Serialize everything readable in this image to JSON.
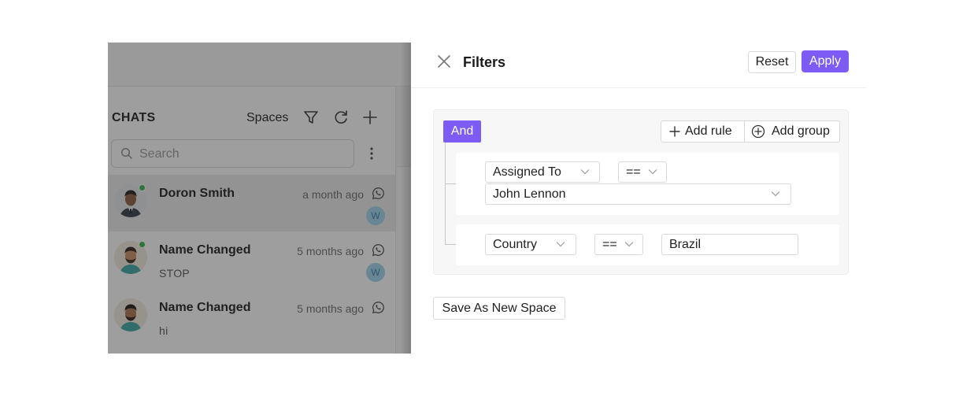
{
  "chats_panel": {
    "title": "CHATS",
    "spaces_label": "Spaces",
    "search_placeholder": "Search",
    "items": [
      {
        "name": "Doron Smith",
        "time": "a month ago",
        "preview": "",
        "badge": "W",
        "online": true
      },
      {
        "name": "Name Changed",
        "time": "5 months ago",
        "preview": "STOP",
        "badge": "W",
        "online": true
      },
      {
        "name": "Name Changed",
        "time": "5 months ago",
        "preview": "hi",
        "badge": "",
        "online": false
      }
    ]
  },
  "filters": {
    "title": "Filters",
    "reset_label": "Reset",
    "apply_label": "Apply",
    "group": {
      "combinator": "And",
      "add_rule_label": "Add rule",
      "add_group_label": "Add group",
      "rules": [
        {
          "field": "Assigned To",
          "operator": "==",
          "value": "John Lennon"
        },
        {
          "field": "Country",
          "operator": "==",
          "value": "Brazil"
        }
      ]
    },
    "save_label": "Save As New Space"
  },
  "colors": {
    "accent": "#7d5cf5",
    "online": "#37b24d",
    "badge_bg": "#9fd3ef"
  }
}
